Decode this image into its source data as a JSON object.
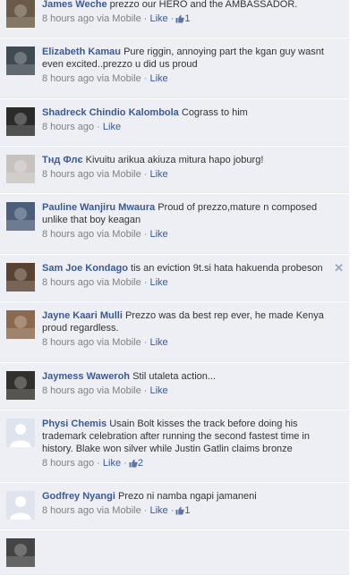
{
  "comments": [
    {
      "author": "James Weche",
      "text": "prezzo our HERO and the AMBASSADOR.",
      "time": "8 hours ago",
      "via": "via Mobile",
      "like_label": "Like",
      "like_count": "1",
      "avatar_color": "#6b5a45"
    },
    {
      "author": "Elizabeth Kamau",
      "text": "Pure riggin, annoying part the kgan guy wasnt even excited..prezzo u did us proud",
      "time": "8 hours ago",
      "via": "via Mobile",
      "like_label": "Like",
      "like_count": "",
      "avatar_color": "#3f4a52"
    },
    {
      "author": "Shadreck Chindio Kalombola",
      "text": "Cograss to him",
      "time": "8 hours ago",
      "via": "",
      "like_label": "Like",
      "like_count": "",
      "avatar_color": "#2b2b2b"
    },
    {
      "author": "Тнд Флє",
      "text": "Kivuitu arikua akiuza mitura hapo joburg!",
      "time": "8 hours ago",
      "via": "via Mobile",
      "like_label": "Like",
      "like_count": "",
      "avatar_color": "#c7c2c0"
    },
    {
      "author": "Pauline Wanjiru Mwaura",
      "text": "Proud of prezzo,mature n composed unlike that boy keagan",
      "time": "8 hours ago",
      "via": "via Mobile",
      "like_label": "Like",
      "like_count": "",
      "avatar_color": "#4d5f78"
    },
    {
      "author": "Sam Joe Kondago",
      "text": "tis an eviction 9t.si hata hakuenda probeson",
      "time": "8 hours ago",
      "via": "via Mobile",
      "like_label": "Like",
      "like_count": "",
      "avatar_color": "#5a4232",
      "removable": true
    },
    {
      "author": "Jayne Kaari Mulli",
      "text": "Prezzo was da best rep ever, he made Kenya proud regardless.",
      "time": "8 hours ago",
      "via": "via Mobile",
      "like_label": "Like",
      "like_count": "",
      "avatar_color": "#8a6a4e"
    },
    {
      "author": "Jaymess Waweroh",
      "text": "Stil utaleta action...",
      "time": "8 hours ago",
      "via": "via Mobile",
      "like_label": "Like",
      "like_count": "",
      "avatar_color": "#33302c"
    },
    {
      "author": "Physi Chemis",
      "text": "Usain Bolt kisses the track before doing his trademark celebration after running the second fastest time in history. Blake won silver while Justin Gatlin claims bronze",
      "time": "8 hours ago",
      "via": "",
      "like_label": "Like",
      "like_count": "2",
      "avatar_color": "#dfe3ee",
      "default_avatar": true
    },
    {
      "author": "Godfrey Nyangi",
      "text": "Prezo ni namba ngapi jamaneni",
      "time": "8 hours ago",
      "via": "via Mobile",
      "like_label": "Like",
      "like_count": "1",
      "avatar_color": "#dfe3ee",
      "default_avatar": true
    },
    {
      "author": "",
      "text": "",
      "time": "",
      "via": "",
      "like_label": "",
      "like_count": "",
      "avatar_color": "#444444"
    }
  ],
  "ui": {
    "separator": "·",
    "remove_glyph": "✕",
    "link_color": "#3b5998",
    "row_background": "#edeff4"
  }
}
